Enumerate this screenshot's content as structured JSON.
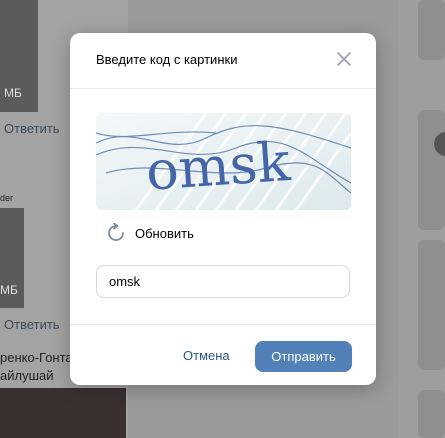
{
  "background": {
    "reply_label": "Ответить",
    "badge_text": "МБ",
    "author_text": "ренко-Гонта",
    "subtitle_text": "айлушай",
    "small_text": "der"
  },
  "dialog": {
    "title": "Введите код с картинки",
    "captcha_text": "omsk",
    "refresh_label": "Обновить",
    "input_value": "omsk",
    "cancel_label": "Отмена",
    "submit_label": "Отправить"
  },
  "colors": {
    "primary": "#5181b8",
    "link": "#2a5885",
    "captcha_ink": "#3f5fa0"
  }
}
